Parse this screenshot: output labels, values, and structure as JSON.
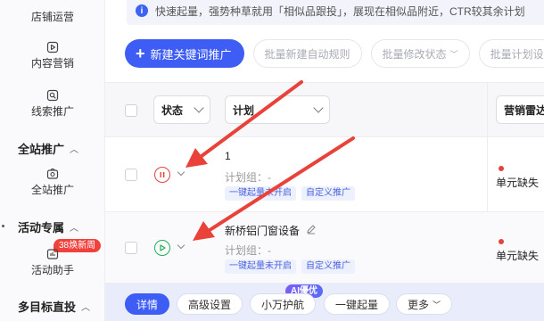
{
  "sidebar": {
    "items": [
      {
        "label": "店铺运营",
        "icon": "store-icon"
      },
      {
        "label": "内容营销",
        "icon": "play-icon"
      },
      {
        "label": "线索推广",
        "icon": "lead-icon"
      },
      {
        "label": "全站推广",
        "icon": "camera-icon"
      },
      {
        "label": "活动助手",
        "icon": "activity-icon"
      }
    ],
    "groups": [
      {
        "label": "全站推广"
      },
      {
        "label": "活动专属"
      },
      {
        "label": "多目标直投"
      }
    ],
    "badge": "38焕新周"
  },
  "notice": {
    "text": "快速起量，强势种草就用「相似品跟投」，展现在相似品附近，CTR较其余计划"
  },
  "toolbar": {
    "new_plan": "新建关键词推广",
    "batch_create_rule": "批量新建自动规则",
    "batch_status": "批量修改状态",
    "batch_plan": "批量计划设"
  },
  "table": {
    "status_header": "状态",
    "plan_header": "计划",
    "radar_header": "营销雷达"
  },
  "rows": [
    {
      "name": "1",
      "group": "计划组：-",
      "tags": [
        "一键起量未开启",
        "自定义推广"
      ],
      "status": "paused",
      "radar": "单元缺失"
    },
    {
      "name": "新桥铝门窗设备",
      "group": "计划组：-",
      "tags": [
        "一键起量未开启",
        "自定义推广"
      ],
      "status": "running",
      "radar": "单元缺失"
    }
  ],
  "actions": {
    "detail": "详情",
    "advanced": "高级设置",
    "xiaowan": "小万护航",
    "boost": "一键起量",
    "more": "更多",
    "ai_badge": "AI優优"
  },
  "colors": {
    "primary": "#3d5df5",
    "danger": "#e0443d",
    "success": "#1fae5b",
    "arrow": "#e8423a"
  }
}
